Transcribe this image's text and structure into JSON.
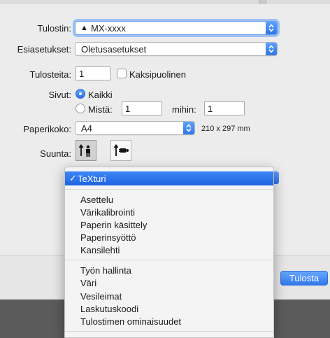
{
  "dialog": {
    "printer": {
      "label": "Tulostin:",
      "value": "MX-xxxx"
    },
    "presets": {
      "label": "Esiasetukset:",
      "value": "Oletusasetukset"
    },
    "copies": {
      "label": "Tulosteita:",
      "value": "1",
      "two_sided_label": "Kaksipuolinen"
    },
    "pages": {
      "label": "Sivut:",
      "all_label": "Kaikki",
      "from_label": "Mistä:",
      "from_value": "1",
      "to_label": "mihin:",
      "to_value": "1"
    },
    "paper": {
      "label": "Paperikoko:",
      "value": "A4",
      "dimensions": "210 x 297 mm"
    },
    "orientation": {
      "label": "Suunta:"
    },
    "print_button": "Tulosta"
  },
  "menu": {
    "selected": "TeXturi",
    "check": "✓",
    "group1": [
      "Asettelu",
      "Värikalibrointi",
      "Paperin käsittely",
      "Paperinsyöttö",
      "Kansilehti"
    ],
    "group2": [
      "Työn hallinta",
      "Väri",
      "Vesileimat",
      "Laskutuskoodi",
      "Tulostimen ominaisuudet"
    ]
  }
}
